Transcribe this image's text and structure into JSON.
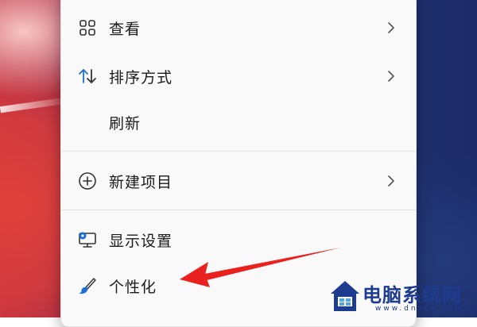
{
  "menu": {
    "items": [
      {
        "label": "查看",
        "icon": "grid-view-icon",
        "has_submenu": true
      },
      {
        "label": "排序方式",
        "icon": "sort-arrows-icon",
        "has_submenu": true
      },
      {
        "label": "刷新",
        "icon": "",
        "has_submenu": false
      },
      {
        "label": "新建项目",
        "icon": "plus-circle-icon",
        "has_submenu": true
      },
      {
        "label": "显示设置",
        "icon": "monitor-settings-icon",
        "has_submenu": false
      },
      {
        "label": "个性化",
        "icon": "paintbrush-icon",
        "has_submenu": false
      }
    ]
  },
  "annotation": {
    "color": "#e8201e"
  },
  "watermark": {
    "brand": "电脑系统网",
    "url": "www.dnxtw.com"
  },
  "colors": {
    "accent": "#1f6fd1",
    "menu_bg": "#f9f9f9",
    "text": "#1b1b1b"
  }
}
